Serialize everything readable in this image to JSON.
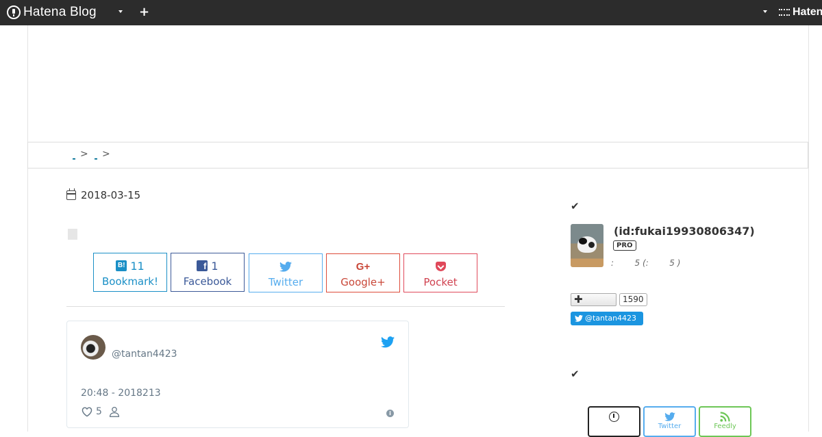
{
  "topbar": {
    "brand": "Hatena Blog",
    "right_brand": "Haten"
  },
  "breadcrumb": {
    "separator": ">"
  },
  "article": {
    "date": "2018-03-15"
  },
  "share": {
    "hatena": {
      "count": "11",
      "label": "Bookmark!"
    },
    "facebook": {
      "count": "1",
      "label": "Facebook"
    },
    "twitter": {
      "label": "Twitter"
    },
    "google": {
      "icon_text": "G+",
      "label": "Google+"
    },
    "pocket": {
      "label": "Pocket"
    }
  },
  "tweet": {
    "handle": "@tantan4423",
    "timestamp": "20:48 - 2018213",
    "likes": "5"
  },
  "sidebar": {
    "profile_id": "(id:fukai19930806347)",
    "badge": "PRO",
    "meta": ":        5 (:        5 )",
    "follow_count": "1590",
    "twitter_follow": "@tantan4423",
    "subscribe": {
      "twitter": "Twitter",
      "feedly": "Feedly"
    }
  },
  "colors": {
    "topbar_bg": "#2c2c2c",
    "hatena_blue": "#1a8fc6",
    "facebook_blue": "#3b5998",
    "twitter_blue": "#55acee",
    "google_red": "#dd4b39",
    "pocket_red": "#e0485a",
    "feedly_green": "#6cc655"
  }
}
